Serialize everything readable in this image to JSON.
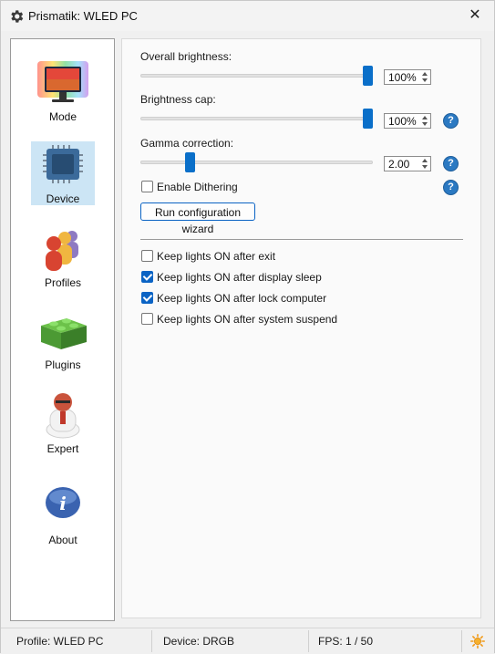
{
  "window": {
    "title": "Prismatik: WLED PC",
    "icons": {
      "app": "gear-icon",
      "close": "close-icon"
    },
    "close_glyph": "✕"
  },
  "sidebar": {
    "items": [
      {
        "label": "Mode",
        "icon": "rainbow-monitor-icon",
        "selected": false
      },
      {
        "label": "Device",
        "icon": "chip-icon",
        "selected": true
      },
      {
        "label": "Profiles",
        "icon": "profiles-people-icon",
        "selected": false
      },
      {
        "label": "Plugins",
        "icon": "lego-brick-icon",
        "selected": false
      },
      {
        "label": "Expert",
        "icon": "expert-figure-icon",
        "selected": false
      },
      {
        "label": "About",
        "icon": "info-icon",
        "selected": false
      }
    ]
  },
  "device": {
    "overall_brightness": {
      "label": "Overall brightness:",
      "value": "100%",
      "level": 1.0
    },
    "brightness_cap": {
      "label": "Brightness cap:",
      "value": "100%",
      "level": 1.0
    },
    "gamma_correction": {
      "label": "Gamma correction:",
      "value": "2.00",
      "level": 0.2
    },
    "enable_dithering": {
      "label": "Enable Dithering",
      "checked": false
    },
    "wizard_button": "Run configuration wizard",
    "help_glyph": "?",
    "keep_lights": [
      {
        "label": "Keep lights ON after exit",
        "checked": false
      },
      {
        "label": "Keep lights ON after display sleep",
        "checked": true
      },
      {
        "label": "Keep lights ON after lock computer",
        "checked": true
      },
      {
        "label": "Keep lights ON after system suspend",
        "checked": false
      }
    ]
  },
  "status": {
    "profile": "Profile: WLED PC",
    "device": "Device: DRGB",
    "fps": "FPS: 1 / 50",
    "toggle_icon": "sun-icon"
  },
  "colors": {
    "accent": "#0a6fc9",
    "help": "#2b79c2",
    "selected_bg": "#cce5f5",
    "sun": "#f29a17"
  }
}
